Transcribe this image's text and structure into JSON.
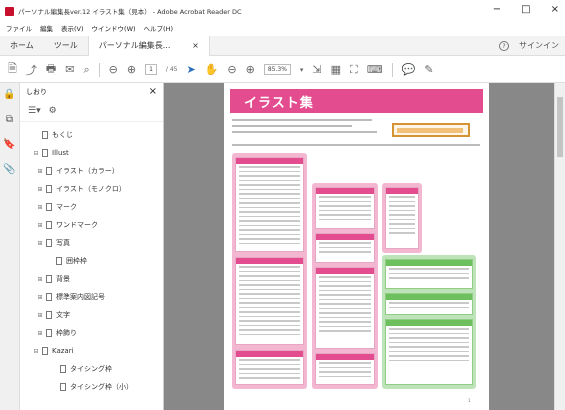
{
  "window": {
    "title": "パーソナル編集長ver.12 イラスト集（見本） - Adobe Acrobat Reader DC",
    "controls": [
      "−",
      "□",
      "×"
    ]
  },
  "menu": [
    "ファイル",
    "編集",
    "表示(V)",
    "ウインドウ(W)",
    "ヘルプ(H)"
  ],
  "tabs": {
    "home": "ホーム",
    "tools": "ツール",
    "doc": "パーソナル編集長...",
    "close": "×",
    "help_icon": "?",
    "signin": "サインイン"
  },
  "toolbar": {
    "page_current": "1",
    "page_total": "/ 45",
    "zoom": "85.3%",
    "zoom_arrow": "▾"
  },
  "bookmarks": {
    "header": "しおり",
    "close": "×",
    "items": [
      {
        "label": "もくじ",
        "level": 0,
        "expand": ""
      },
      {
        "label": "Illust",
        "level": 0,
        "expand": "⊟"
      },
      {
        "label": "イラスト（カラー）",
        "level": 1,
        "expand": "⊞"
      },
      {
        "label": "イラスト（モノクロ）",
        "level": 1,
        "expand": "⊞"
      },
      {
        "label": "マーク",
        "level": 1,
        "expand": "⊞"
      },
      {
        "label": "ワンドマーク",
        "level": 1,
        "expand": "⊞"
      },
      {
        "label": "写真",
        "level": 1,
        "expand": "⊞"
      },
      {
        "label": "囲枠枠",
        "level": 1,
        "expand": ""
      },
      {
        "label": "背景",
        "level": 1,
        "expand": "⊞"
      },
      {
        "label": "標準案内図記号",
        "level": 1,
        "expand": "⊞"
      },
      {
        "label": "文字",
        "level": 1,
        "expand": "⊞"
      },
      {
        "label": "枠飾り",
        "level": 1,
        "expand": "⊞"
      },
      {
        "label": "Kazari",
        "level": 0,
        "expand": "⊟"
      },
      {
        "label": "タイシング枠",
        "level": 2,
        "expand": ""
      },
      {
        "label": "タイシング枠（小）",
        "level": 2,
        "expand": ""
      }
    ]
  },
  "document": {
    "banner_title": "イラスト集",
    "page_number": "1"
  },
  "colors": {
    "accent_pink": "#e34d8f",
    "accent_green": "#6ebf5e",
    "accent_orange": "#d49436"
  }
}
